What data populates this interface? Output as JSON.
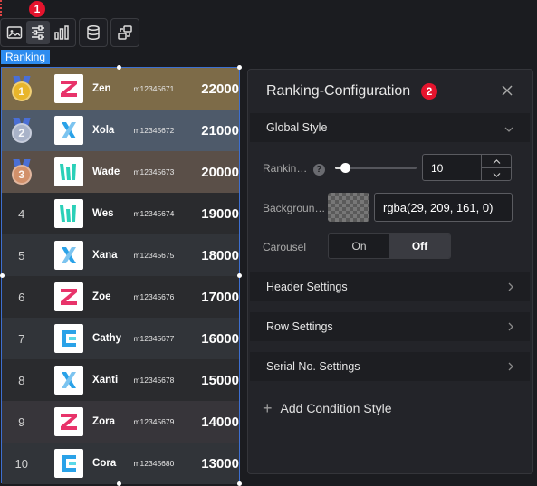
{
  "toolbar": {
    "badge": "1",
    "groups": [
      [
        "image-icon",
        "sliders-icon",
        "bar-chart-icon"
      ],
      [
        "database-icon"
      ],
      [
        "link-flow-icon"
      ]
    ],
    "active": "sliders-icon"
  },
  "component_tag": "Ranking",
  "ranking": {
    "rows": [
      {
        "rank": "1",
        "medal": "gold",
        "logo": "Z",
        "logo_color": "#e8336a",
        "name": "Zen",
        "id": "m12345671",
        "score": "22000",
        "bg": "#7d6b48"
      },
      {
        "rank": "2",
        "medal": "silver",
        "logo": "X",
        "logo_color": "#2aa2e8",
        "name": "Xola",
        "id": "m12345672",
        "score": "21000",
        "bg": "#4e5a6a"
      },
      {
        "rank": "3",
        "medal": "bronze",
        "logo": "W",
        "logo_color": "#2ad0b8",
        "name": "Wade",
        "id": "m12345673",
        "score": "20000",
        "bg": "#5a4f48"
      },
      {
        "rank": "4",
        "medal": "",
        "logo": "W",
        "logo_color": "#2ad0b8",
        "name": "Wes",
        "id": "m12345674",
        "score": "19000",
        "bg": "#2a2b2e"
      },
      {
        "rank": "5",
        "medal": "",
        "logo": "X",
        "logo_color": "#2aa2e8",
        "name": "Xana",
        "id": "m12345675",
        "score": "18000",
        "bg": "#313439"
      },
      {
        "rank": "6",
        "medal": "",
        "logo": "Z",
        "logo_color": "#e8336a",
        "name": "Zoe",
        "id": "m12345676",
        "score": "17000",
        "bg": "#2a2b2e"
      },
      {
        "rank": "7",
        "medal": "",
        "logo": "C",
        "logo_color": "#2aa2e8",
        "name": "Cathy",
        "id": "m12345677",
        "score": "16000",
        "bg": "#313439"
      },
      {
        "rank": "8",
        "medal": "",
        "logo": "X",
        "logo_color": "#2aa2e8",
        "name": "Xanti",
        "id": "m12345678",
        "score": "15000",
        "bg": "#2a2b2e"
      },
      {
        "rank": "9",
        "medal": "",
        "logo": "Z",
        "logo_color": "#e8336a",
        "name": "Zora",
        "id": "m12345679",
        "score": "14000",
        "bg": "#37353a"
      },
      {
        "rank": "10",
        "medal": "",
        "logo": "C",
        "logo_color": "#2aa2e8",
        "name": "Cora",
        "id": "m12345680",
        "score": "13000",
        "bg": "#313439"
      }
    ]
  },
  "panel": {
    "title": "Ranking-Configuration",
    "badge": "2",
    "close_icon": "close-icon",
    "global_style": {
      "label": "Global Style",
      "ranking_label": "Rankin…",
      "ranking_value": "10",
      "slider_fraction": 0.12,
      "background_label": "Backgroun…",
      "background_value": "rgba(29, 209, 161, 0)",
      "carousel_label": "Carousel",
      "carousel_on": "On",
      "carousel_off": "Off",
      "carousel_selected": "Off"
    },
    "sections": [
      {
        "label": "Header Settings"
      },
      {
        "label": "Row Settings"
      },
      {
        "label": "Serial No. Settings"
      }
    ],
    "add_condition": "Add Condition Style"
  }
}
